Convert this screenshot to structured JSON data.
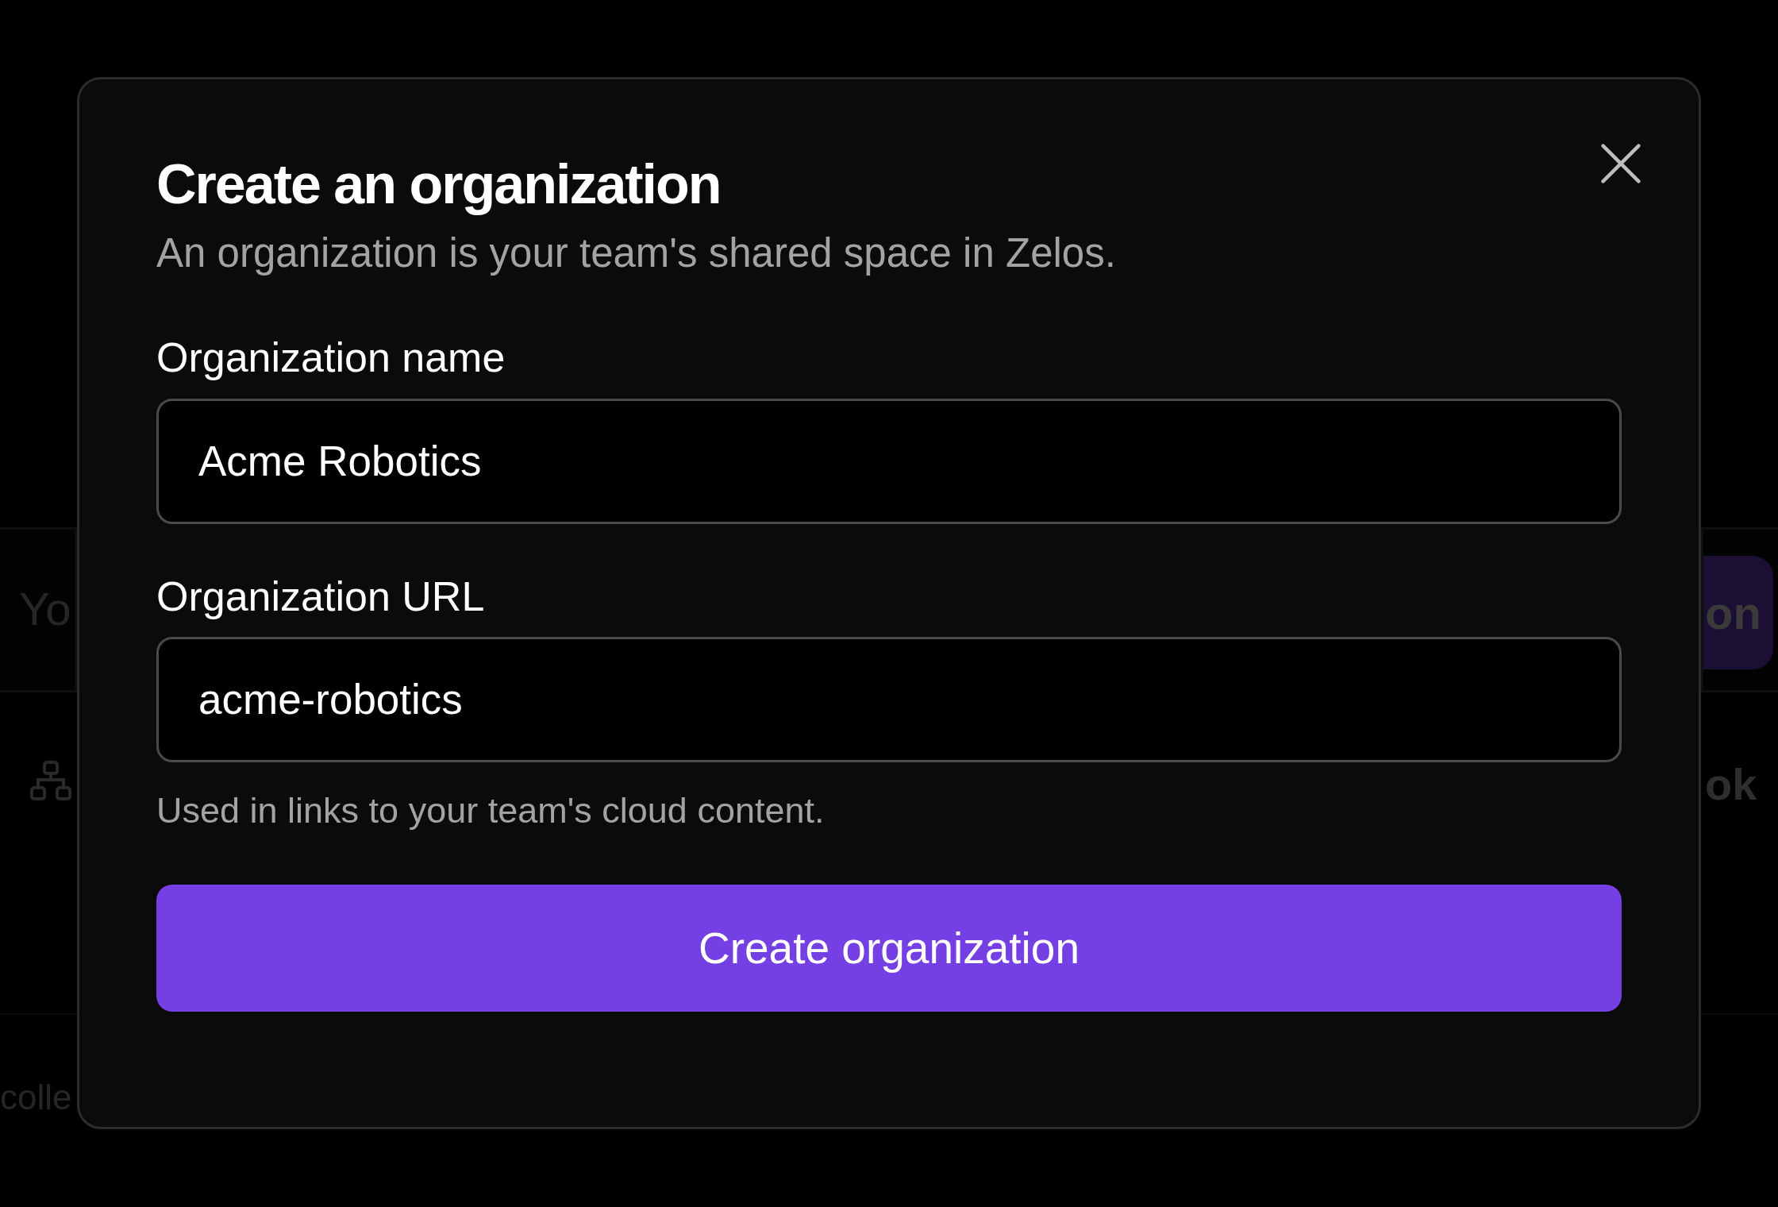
{
  "background": {
    "card_text": "Yo",
    "action_button": "on",
    "row_text": "ok",
    "footer_text": "colle"
  },
  "dialog": {
    "title": "Create an organization",
    "subtitle": "An organization is your team's shared space in Zelos.",
    "fields": [
      {
        "label": "Organization name",
        "value": "Acme Robotics"
      },
      {
        "label": "Organization URL",
        "value": "acme-robotics",
        "help": "Used in links to your team's cloud content."
      }
    ],
    "submit": "Create organization"
  }
}
